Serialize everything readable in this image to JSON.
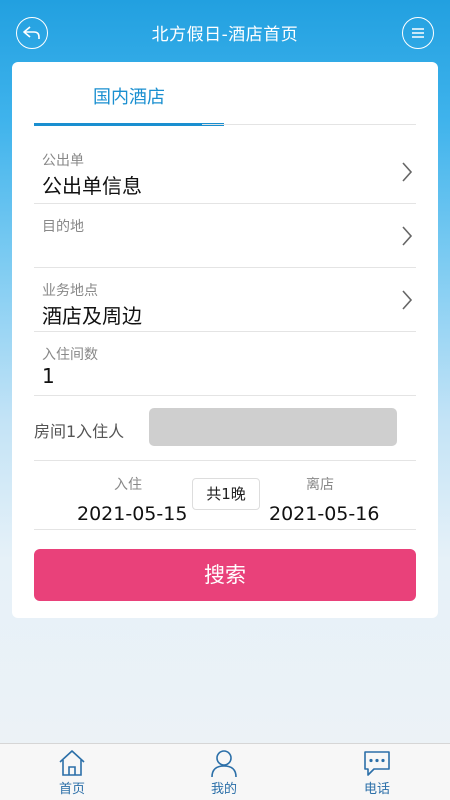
{
  "header": {
    "title": "北方假日-酒店首页",
    "back_icon": "back-icon",
    "menu_icon": "menu-icon"
  },
  "tabs": [
    {
      "label": "国内酒店",
      "active": true
    }
  ],
  "form": {
    "official_order": {
      "label": "公出单",
      "value": "公出单信息"
    },
    "destination": {
      "label": "目的地",
      "value": ""
    },
    "business_location": {
      "label": "业务地点",
      "value": "酒店及周边"
    },
    "room_count": {
      "label": "入住间数",
      "value": "1"
    },
    "room_guest": {
      "label": "房间1入住人",
      "value": ""
    },
    "check_in": {
      "label": "入住",
      "value": "2021-05-15"
    },
    "check_out": {
      "label": "离店",
      "value": "2021-05-16"
    },
    "nights": "共1晚",
    "search_label": "搜索"
  },
  "bottom_nav": [
    {
      "label": "首页",
      "icon": "home-icon"
    },
    {
      "label": "我的",
      "icon": "user-icon"
    },
    {
      "label": "电话",
      "icon": "chat-icon"
    }
  ],
  "colors": {
    "accent": "#1a8fd0",
    "search_button": "#e9417a",
    "nav_label": "#2b6fa8"
  }
}
